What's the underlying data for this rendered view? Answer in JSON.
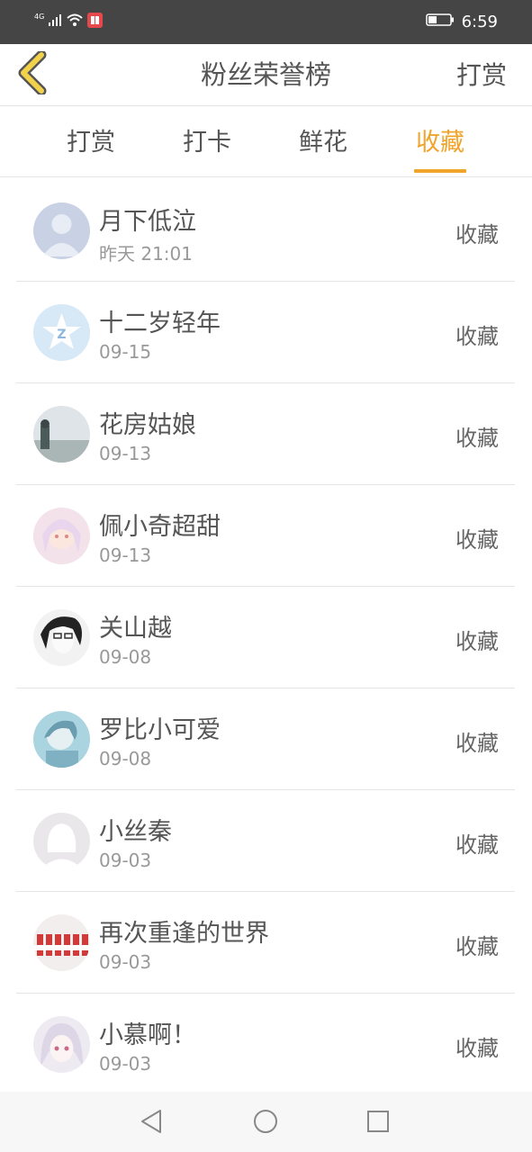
{
  "status_bar": {
    "network": "4G",
    "time": "6:59",
    "icons": [
      "signal-icon",
      "wifi-icon",
      "notification-app-icon",
      "battery-icon"
    ]
  },
  "header": {
    "title": "粉丝荣誉榜",
    "action_label": "打赏",
    "back_icon": "chevron-left-icon"
  },
  "tabs": [
    {
      "label": "打赏",
      "active": false
    },
    {
      "label": "打卡",
      "active": false
    },
    {
      "label": "鲜花",
      "active": false
    },
    {
      "label": "收藏",
      "active": true
    }
  ],
  "colors": {
    "accent": "#f0a42b",
    "status_bar": "#454545",
    "back_icon_fill": "#f1d24a",
    "text_primary": "#555555",
    "text_secondary": "#999999"
  },
  "list": [
    {
      "name": "月下低泣",
      "date": "昨天 21:01",
      "action": "收藏",
      "avatar": "default-avatar-icon"
    },
    {
      "name": "十二岁轻年",
      "date": "09-15",
      "action": "收藏",
      "avatar": "qzone-avatar-icon"
    },
    {
      "name": "花房姑娘",
      "date": "09-13",
      "action": "收藏",
      "avatar": "photo-avatar"
    },
    {
      "name": "佩小奇超甜",
      "date": "09-13",
      "action": "收藏",
      "avatar": "anime-avatar"
    },
    {
      "name": "关山越",
      "date": "09-08",
      "action": "收藏",
      "avatar": "sketch-avatar"
    },
    {
      "name": "罗比小可爱",
      "date": "09-08",
      "action": "收藏",
      "avatar": "illustration-avatar"
    },
    {
      "name": "小丝秦",
      "date": "09-03",
      "action": "收藏",
      "avatar": "female-silhouette-avatar"
    },
    {
      "name": "再次重逢的世界",
      "date": "09-03",
      "action": "收藏",
      "avatar": "group-photo-avatar"
    },
    {
      "name": "小慕啊！",
      "date": "09-03",
      "action": "收藏",
      "avatar": "anime-girl-avatar"
    }
  ],
  "nav_bar": {
    "buttons": [
      "back-triangle-icon",
      "home-circle-icon",
      "recents-square-icon"
    ]
  }
}
